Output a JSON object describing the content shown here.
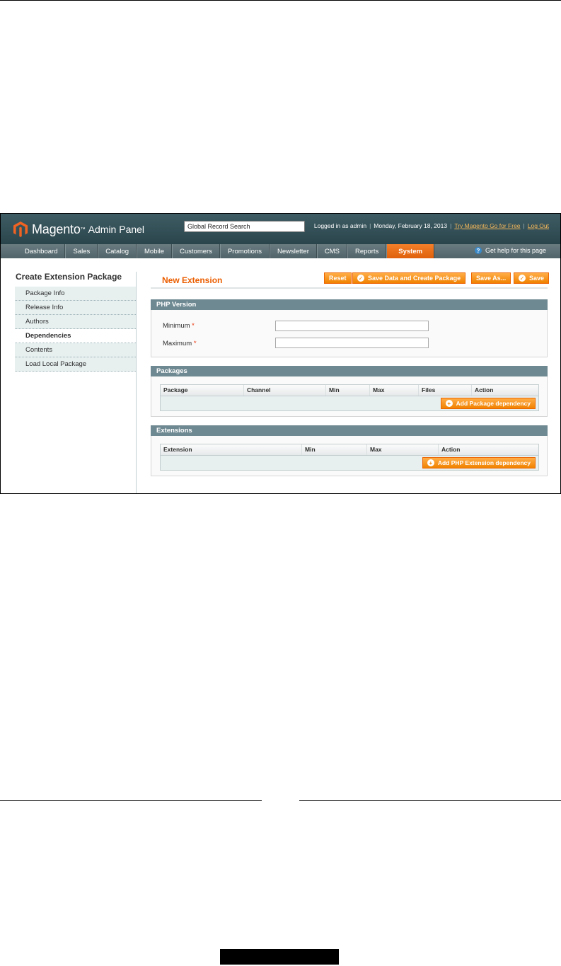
{
  "header": {
    "logo_text": "Magento",
    "logo_tm": "™",
    "logo_sub": "Admin Panel",
    "search_value": "Global Record Search",
    "logged_in": "Logged in as admin",
    "date": "Monday, February 18, 2013",
    "try_link": "Try Magento Go for Free",
    "logout_link": "Log Out",
    "separator": "|"
  },
  "nav": {
    "items": [
      "Dashboard",
      "Sales",
      "Catalog",
      "Mobile",
      "Customers",
      "Promotions",
      "Newsletter",
      "CMS",
      "Reports",
      "System"
    ],
    "active": "System",
    "help_icon": "?",
    "help": "Get help for this page"
  },
  "sidebar": {
    "title": "Create Extension Package",
    "items": [
      "Package Info",
      "Release Info",
      "Authors",
      "Dependencies",
      "Contents",
      "Load Local Package"
    ],
    "active": "Dependencies"
  },
  "content": {
    "title": "New Extension",
    "buttons": {
      "reset": "Reset",
      "save_create": "Save Data and Create Package",
      "save_as": "Save As...",
      "save": "Save",
      "ok_icon": "✓"
    },
    "php_version": {
      "heading": "PHP Version",
      "minimum": "Minimum",
      "maximum": "Maximum",
      "required_mark": "*"
    },
    "packages": {
      "heading": "Packages",
      "columns": [
        "Package",
        "Channel",
        "Min",
        "Max",
        "Files",
        "Action"
      ],
      "add_icon": "+",
      "add_button": "Add Package dependency"
    },
    "extensions": {
      "heading": "Extensions",
      "columns": [
        "Extension",
        "Min",
        "Max",
        "Action"
      ],
      "add_icon": "+",
      "add_button": "Add PHP Extension dependency"
    }
  },
  "colors": {
    "accent": "#eb5e00",
    "header_bg": "#2b454c",
    "nav_bg": "#50646a",
    "section_head": "#6f8992",
    "sidebar_bg": "#e7efef"
  }
}
